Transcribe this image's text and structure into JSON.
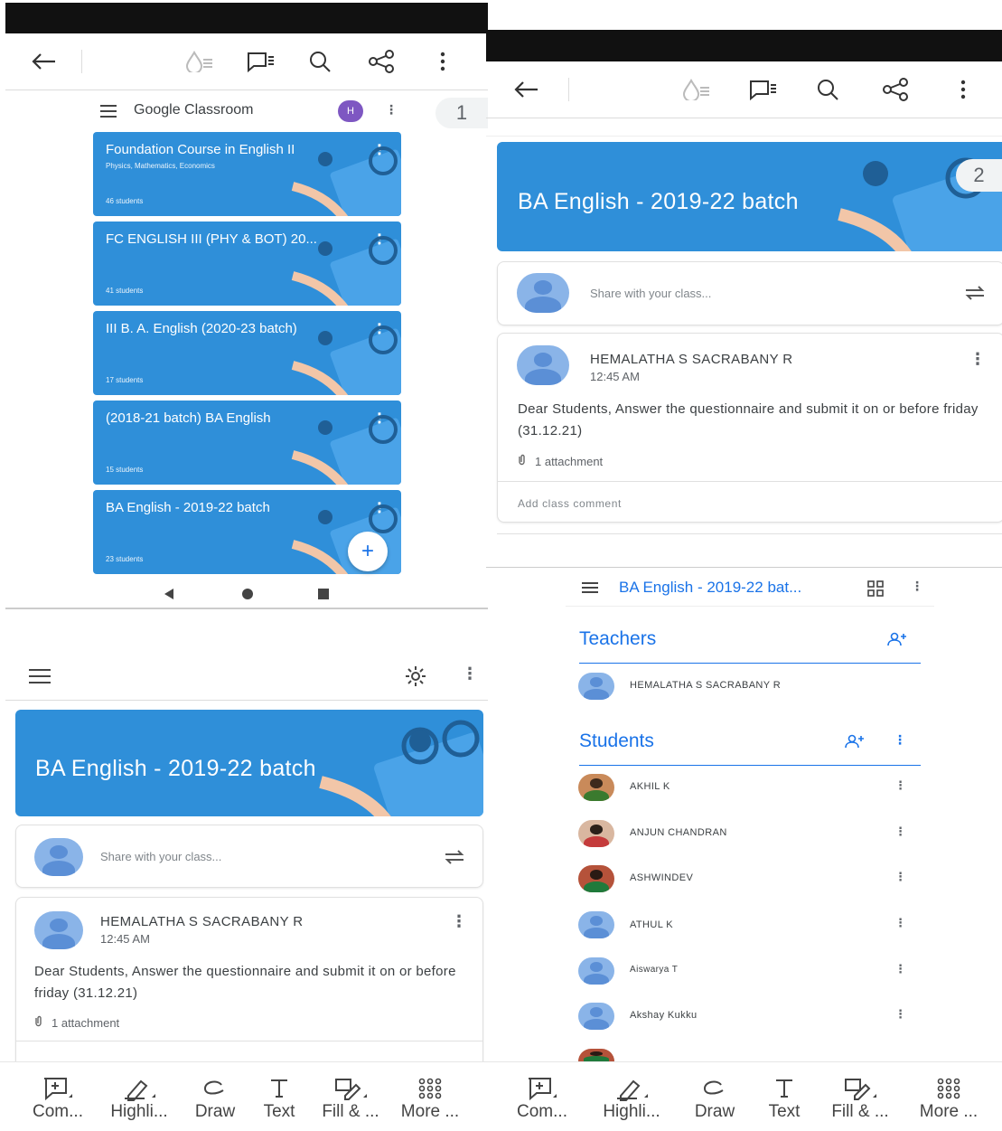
{
  "panel1": {
    "header_title": "Google Classroom",
    "account_initial": "H",
    "page_number": "1",
    "classes": [
      {
        "title": "Foundation Course in English II",
        "subtitle": "Physics, Mathematics, Economics",
        "students": "46 students"
      },
      {
        "title": "FC ENGLISH III (PHY & BOT) 20...",
        "subtitle": "",
        "students": "41 students"
      },
      {
        "title": "III B. A. English (2020-23 batch)",
        "subtitle": "",
        "students": "17 students"
      },
      {
        "title": "(2018-21 batch) BA English",
        "subtitle": "",
        "students": "15 students"
      },
      {
        "title": "BA English - 2019-22 batch",
        "subtitle": "",
        "students": "23 students"
      }
    ],
    "fab_label": "+"
  },
  "panel2": {
    "page_number": "2",
    "banner_title": "BA English - 2019-22 batch",
    "share_placeholder": "Share with your class...",
    "post": {
      "author": "HEMALATHA S SACRABANY R",
      "time": "12:45 AM",
      "body": "Dear Students, Answer the questionnaire and submit it on or before friday (31.12.21)",
      "attachment": "1 attachment",
      "comment_placeholder": "Add class comment"
    }
  },
  "panel3": {
    "banner_title": "BA English - 2019-22 batch",
    "share_placeholder": "Share with your class...",
    "post": {
      "author": "HEMALATHA S SACRABANY R",
      "time": "12:45 AM",
      "body": "Dear Students, Answer the questionnaire and submit it on or before friday (31.12.21)",
      "attachment": "1 attachment"
    }
  },
  "panel4": {
    "header_title": "BA English - 2019-22 bat...",
    "teachers_title": "Teachers",
    "teacher_name": "HEMALATHA S SACRABANY R",
    "students_title": "Students",
    "students": [
      "AKHIL K",
      "ANJUN CHANDRAN",
      "ASHWINDEV",
      "ATHUL K",
      "Aiswarya T",
      "Akshay Kukku"
    ]
  },
  "toolbar": {
    "items": [
      "Com...",
      "Highli...",
      "Draw",
      "Text",
      "Fill & ...",
      "More ..."
    ]
  },
  "icons": [
    "back-arrow-icon",
    "reading-mode-icon",
    "comment-icon",
    "search-icon",
    "share-icon",
    "more-vert-icon",
    "menu-icon",
    "settings-icon",
    "repost-icon",
    "paperclip-icon",
    "add-person-icon",
    "grid-icon",
    "comment-add-icon",
    "highlighter-icon",
    "draw-icon",
    "text-icon",
    "fill-sign-icon",
    "more-grid-icon"
  ],
  "colors": {
    "card_blue": "#2f8fd9",
    "link_blue": "#1a73e8",
    "account_purple": "#7e57c2",
    "status_bar": "#111111"
  }
}
